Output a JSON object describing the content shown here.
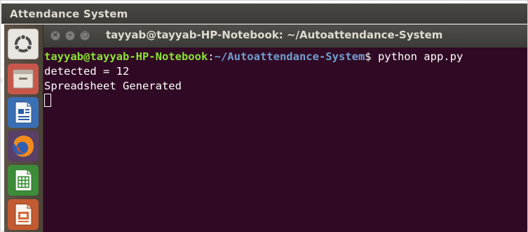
{
  "system_bar": {
    "title": "Attendance System"
  },
  "launcher": {
    "items": [
      {
        "name": "dash",
        "icon": "ubuntu-logo-icon"
      },
      {
        "name": "files",
        "icon": "file-manager-icon"
      },
      {
        "name": "writer",
        "icon": "libreoffice-writer-icon"
      },
      {
        "name": "firefox",
        "icon": "firefox-icon"
      },
      {
        "name": "calc",
        "icon": "libreoffice-calc-icon"
      },
      {
        "name": "impress",
        "icon": "libreoffice-impress-icon"
      }
    ]
  },
  "terminal": {
    "window_title": "tayyab@tayyab-HP-Notebook: ~/Autoattendance-System",
    "prompt": {
      "user_host": "tayyab@tayyab-HP-Notebook",
      "separator": ":",
      "path": "~/Autoattendance-System",
      "symbol": "$",
      "command": " python app.py"
    },
    "output": [
      "detected = 12",
      "Spreadsheet Generated"
    ]
  },
  "colors": {
    "terminal_bg": "#300a24",
    "prompt_user": "#8ae234",
    "prompt_path": "#729fcf",
    "titlebar": "#3c3b37",
    "launcher": "#574c41"
  }
}
